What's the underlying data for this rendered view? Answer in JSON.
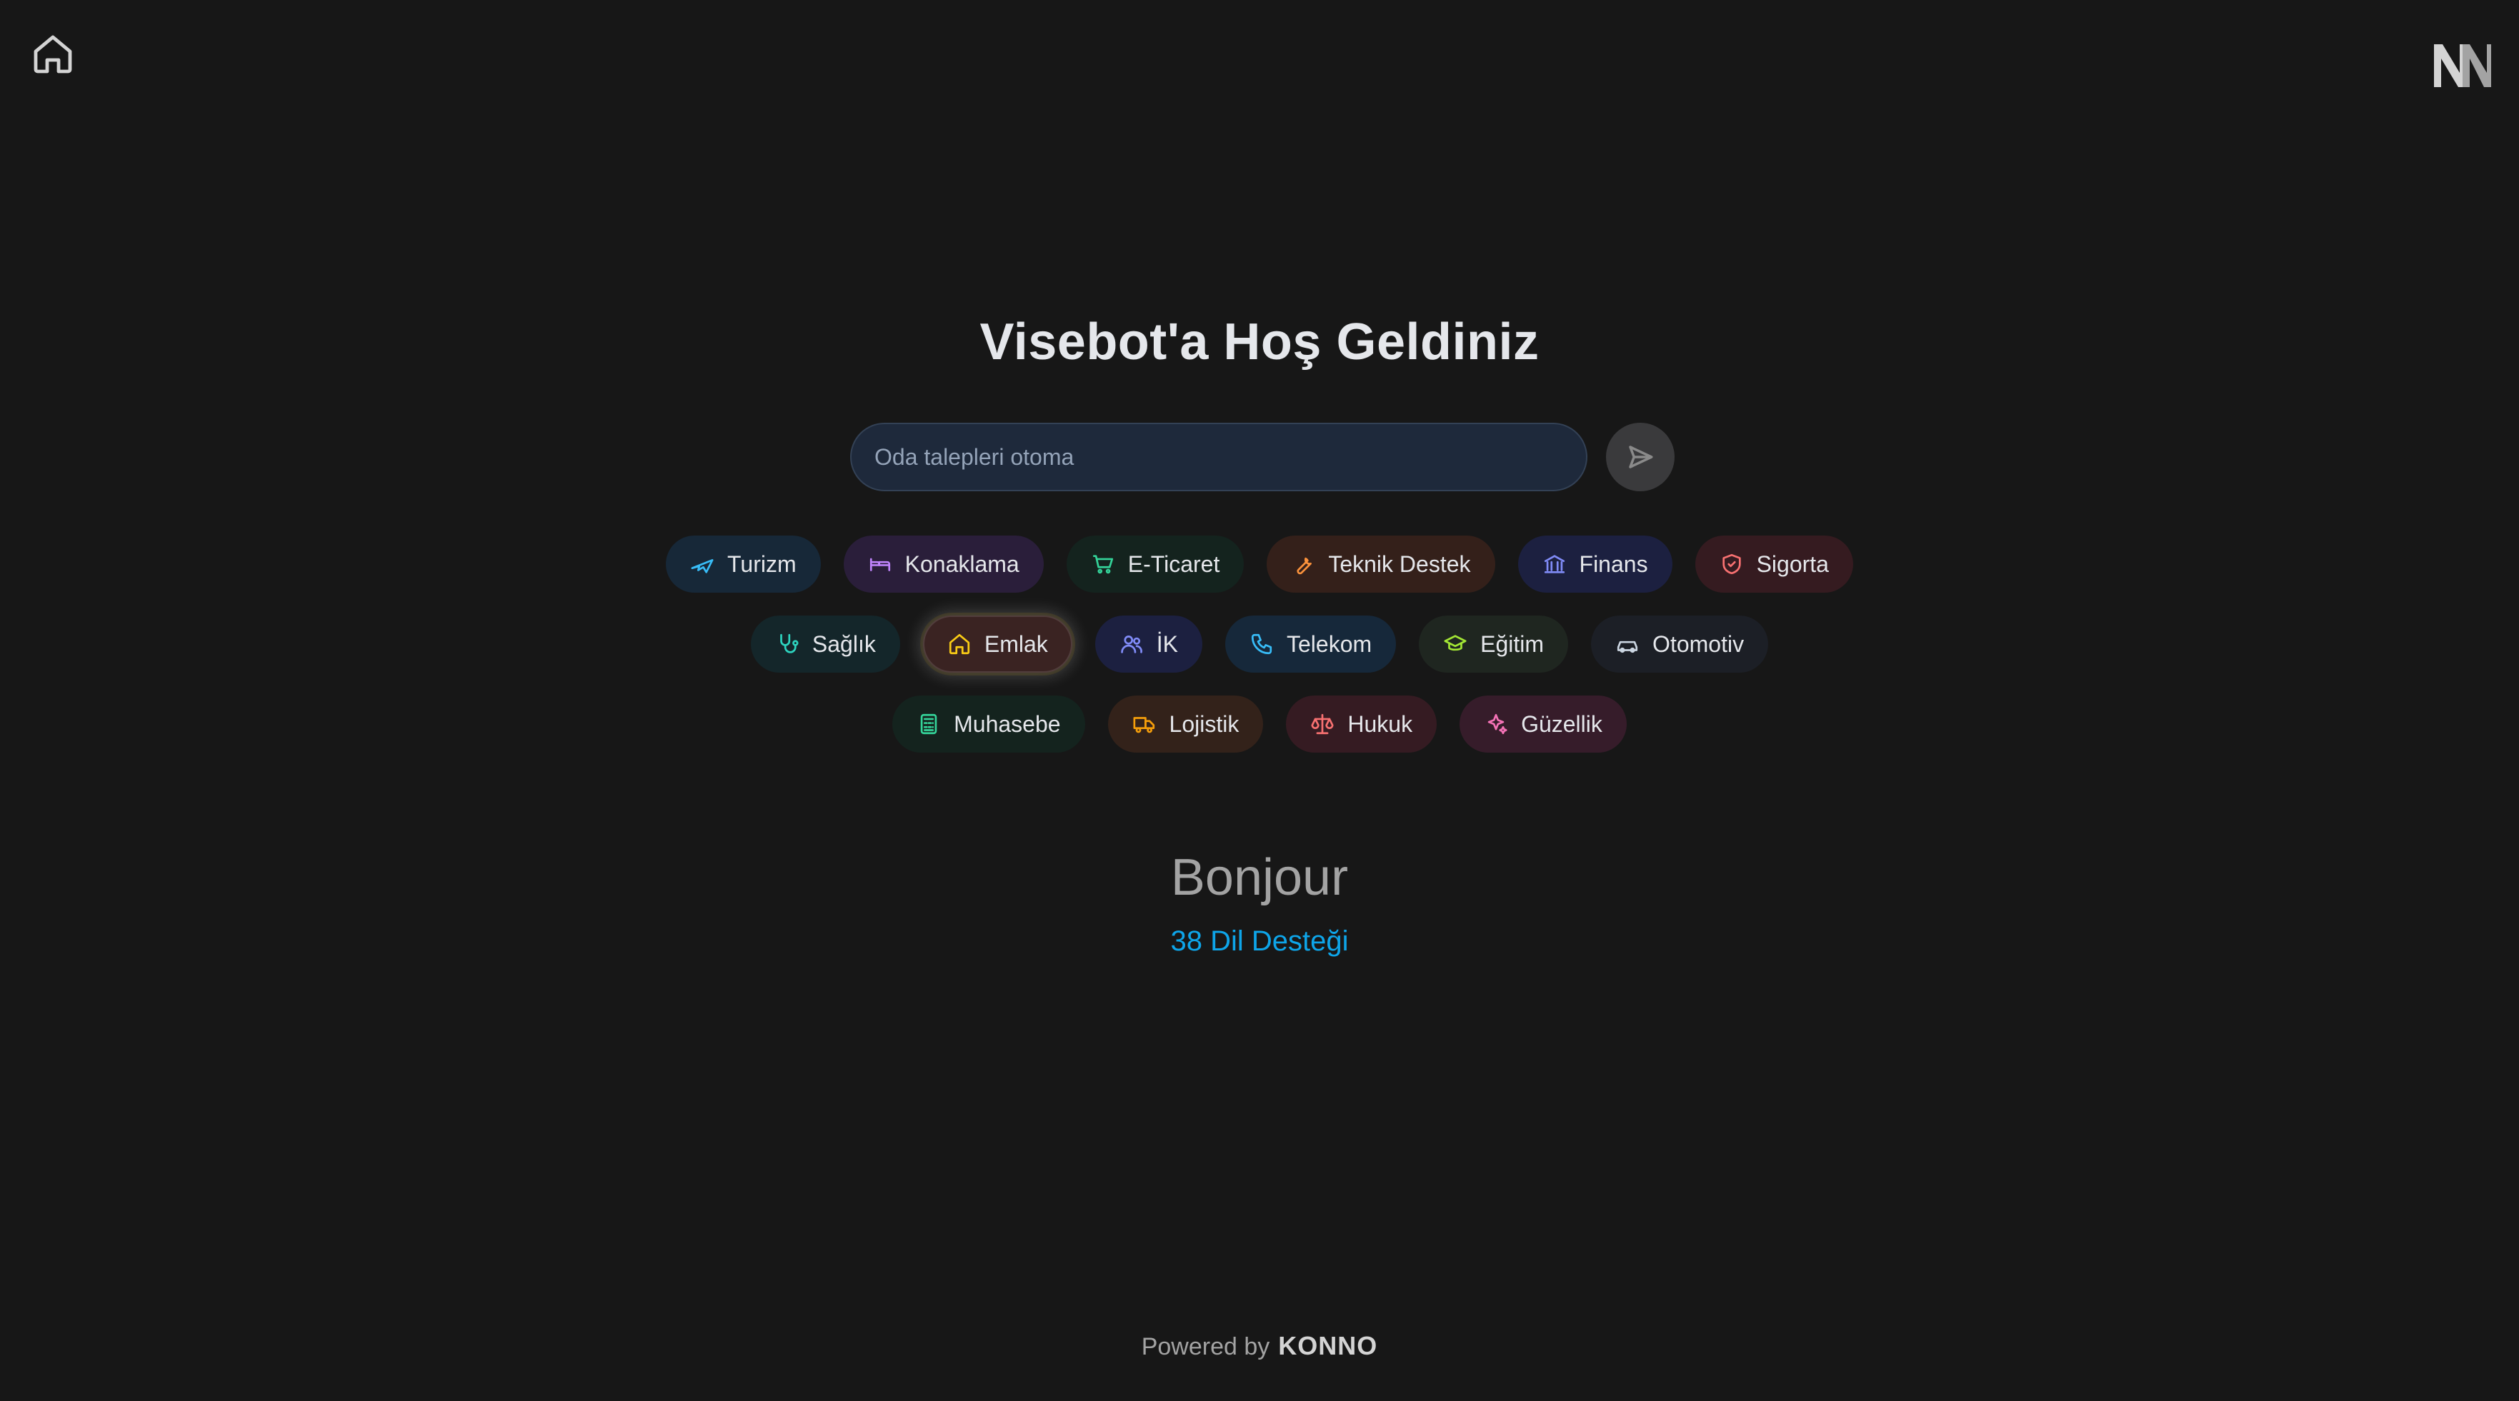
{
  "header": {
    "home_icon": "home-icon",
    "logo_icon": "brand-n-logo"
  },
  "main": {
    "title": "Visebot'a Hoş Geldiniz",
    "search": {
      "placeholder": "Oda talepleri otoma",
      "value": "",
      "send_icon": "send-icon"
    },
    "chips": [
      [
        {
          "label": "Turizm",
          "icon": "plane-icon",
          "color": "#38bdf8",
          "bg": "#172838"
        },
        {
          "label": "Konaklama",
          "icon": "bed-icon",
          "color": "#c084fc",
          "bg": "#2a1e3a"
        },
        {
          "label": "E-Ticaret",
          "icon": "cart-icon",
          "color": "#34d399",
          "bg": "#14231e"
        },
        {
          "label": "Teknik Destek",
          "icon": "wrench-icon",
          "color": "#fb923c",
          "bg": "#34201a"
        },
        {
          "label": "Finans",
          "icon": "bank-icon",
          "color": "#818cf8",
          "bg": "#1c2040"
        },
        {
          "label": "Sigorta",
          "icon": "shield-icon",
          "color": "#f87171",
          "bg": "#351b20"
        }
      ],
      [
        {
          "label": "Sağlık",
          "icon": "stethoscope-icon",
          "color": "#2dd4bf",
          "bg": "#14262a"
        },
        {
          "label": "Emlak",
          "icon": "house-icon",
          "color": "#facc15",
          "bg": "#3a2322",
          "active": true
        },
        {
          "label": "İK",
          "icon": "users-icon",
          "color": "#818cf8",
          "bg": "#1c2040"
        },
        {
          "label": "Telekom",
          "icon": "phone-icon",
          "color": "#38bdf8",
          "bg": "#16283a"
        },
        {
          "label": "Eğitim",
          "icon": "graduation-cap-icon",
          "color": "#a3e635",
          "bg": "#1f2620"
        },
        {
          "label": "Otomotiv",
          "icon": "car-icon",
          "color": "#cbd5e1",
          "bg": "#1c1f26"
        }
      ],
      [
        {
          "label": "Muhasebe",
          "icon": "calculator-icon",
          "color": "#34d399",
          "bg": "#14231e"
        },
        {
          "label": "Lojistik",
          "icon": "truck-icon",
          "color": "#f59e0b",
          "bg": "#33221a"
        },
        {
          "label": "Hukuk",
          "icon": "scales-icon",
          "color": "#f87171",
          "bg": "#351b22"
        },
        {
          "label": "Güzellik",
          "icon": "sparkles-icon",
          "color": "#f472b6",
          "bg": "#361c2a"
        }
      ]
    ],
    "greeting": "Bonjour",
    "language_support": "38 Dil Desteği"
  },
  "footer": {
    "powered_by": "Powered by",
    "brand": "KONNO"
  },
  "colors": {
    "background": "#171717",
    "accent": "#0ea5e9"
  }
}
